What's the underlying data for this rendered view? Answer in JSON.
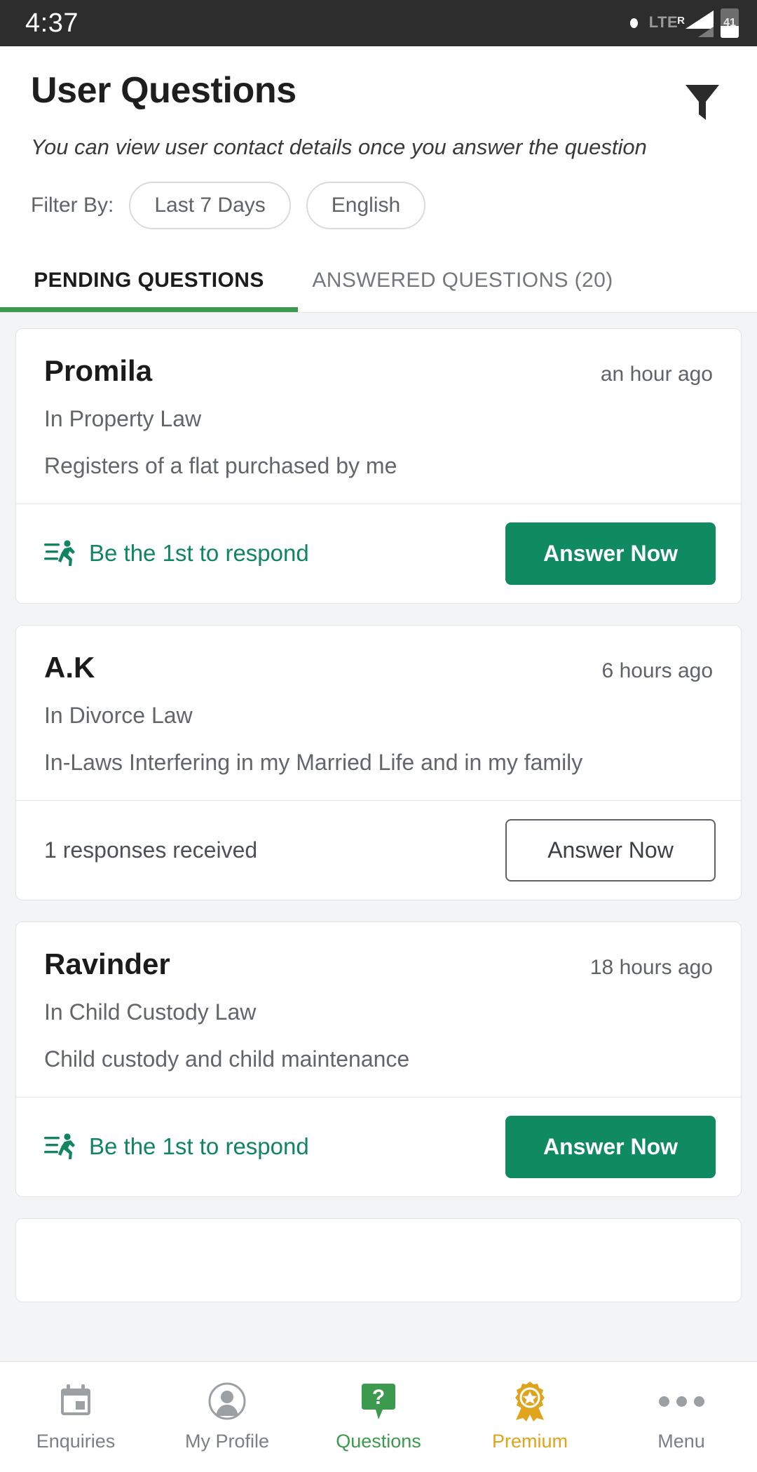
{
  "statusbar": {
    "time": "4:37",
    "network": "LTE",
    "network_sup": "R",
    "battery": "41"
  },
  "header": {
    "title": "User Questions",
    "subtitle": "You can view user contact details once you answer the question",
    "filter_icon": "funnel-icon",
    "filter_label": "Filter By:",
    "chips": [
      {
        "label": "Last 7 Days"
      },
      {
        "label": "English"
      }
    ]
  },
  "tabs": [
    {
      "label": "PENDING QUESTIONS",
      "active": true
    },
    {
      "label": "ANSWERED QUESTIONS (20)",
      "active": false
    }
  ],
  "cards": [
    {
      "asker": "Promila",
      "ago": "an hour ago",
      "practice": "In Property Law",
      "question": "Registers of a flat purchased by me",
      "status": "Be the 1st to respond",
      "status_icon": "runner-icon",
      "button": "Answer Now",
      "button_style": "solid"
    },
    {
      "asker": "A.K",
      "ago": "6 hours ago",
      "practice": "In Divorce Law",
      "question": "In-Laws Interfering in my Married Life and in my family",
      "status": "1 responses received",
      "status_icon": "",
      "button": "Answer Now",
      "button_style": "outline"
    },
    {
      "asker": "Ravinder",
      "ago": "18 hours ago",
      "practice": "In Child Custody Law",
      "question": "Child custody and child maintenance",
      "status": "Be the 1st to respond",
      "status_icon": "runner-icon",
      "button": "Answer Now",
      "button_style": "solid"
    }
  ],
  "bottomnav": [
    {
      "label": "Enquiries",
      "icon": "calendar-icon",
      "active": false
    },
    {
      "label": "My Profile",
      "icon": "avatar-icon",
      "active": false
    },
    {
      "label": "Questions",
      "icon": "question-bubble-icon",
      "active": true
    },
    {
      "label": "Premium",
      "icon": "award-ribbon-icon",
      "active": true
    },
    {
      "label": "Menu",
      "icon": "more-dots-icon",
      "active": false
    }
  ],
  "colors": {
    "accent_green": "#0f8a61",
    "tab_green": "#3c9a4e",
    "premium_gold": "#dfa41c",
    "muted_gray": "#5f6368"
  }
}
